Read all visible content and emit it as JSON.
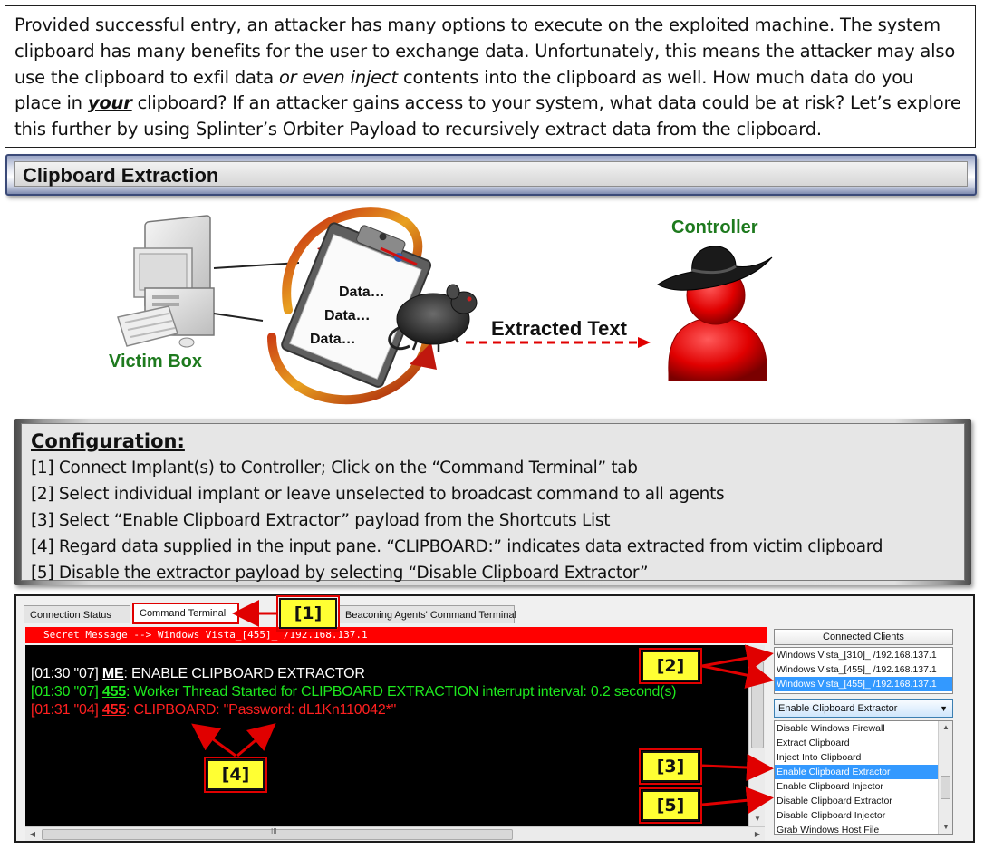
{
  "intro": {
    "line1": "Provided successful entry, an attacker has many options to execute on the exploited machine. The system",
    "line2": "clipboard has many benefits for the user to exchange data.  Unfortunately, this means the attacker may also",
    "line3_a": "use the clipboard to exfil data ",
    "line3_em": "or even inject",
    "line3_b": " contents into the clipboard as well.  How much data do you",
    "line4_a": "place in ",
    "line4_b": "your",
    "line4_c": " clipboard? If an attacker gains access to your system, what data could be at risk?  Let’s explore",
    "line5": "this further by using Splinter’s Orbiter Payload to recursively extract data from the clipboard."
  },
  "section_title": "Clipboard Extraction",
  "diagram": {
    "victim_label": "Victim Box",
    "controller_label": "Controller",
    "extracted_label": "Extracted Text",
    "clipboard_lines": [
      "Data…",
      "Data…",
      "Data…"
    ]
  },
  "configuration": {
    "title": "Configuration:",
    "steps": [
      "[1] Connect Implant(s) to Controller; Click on the “Command Terminal” tab",
      "[2] Select individual implant or leave unselected to broadcast command to all agents",
      "[3] Select “Enable Clipboard Extractor” payload from the Shortcuts List",
      "[4] Regard data supplied in the input pane.  “CLIPBOARD:” indicates data extracted from victim clipboard",
      "[5] Disable the extractor payload by selecting “Disable Clipboard Extractor”"
    ]
  },
  "app": {
    "tabs": [
      "Connection Status",
      "Command Terminal",
      "Beaconing Agents' Command Terminal"
    ],
    "active_tab": "Command Terminal",
    "secret_message": "Secret Message --> Windows Vista_[455]_ /192.168.137.1",
    "terminal": [
      {
        "time": "[01:30 \"07] ",
        "who": "ME",
        "sep": ":  ",
        "text": "ENABLE CLIPBOARD EXTRACTOR",
        "color": "white"
      },
      {
        "time": "[01:30 \"07] ",
        "who": "455",
        "sep": ":  ",
        "text": "Worker Thread Started for CLIPBOARD EXTRACTION interrupt interval: 0.2 second(s)",
        "color": "green"
      },
      {
        "time": "[01:31 \"04] ",
        "who": "455",
        "sep": ":  ",
        "text": "CLIPBOARD: \"Password: dL1Kn110042*\"",
        "color": "red"
      }
    ],
    "scroll_grip": "III",
    "clients_header": "Connected Clients",
    "clients": [
      "Windows Vista_[310]_ /192.168.137.1",
      "Windows Vista_[455]_ /192.168.137.1",
      "Windows Vista_[455]_ /192.168.137.1"
    ],
    "selected_client_index": 2,
    "combo_value": "Enable Clipboard Extractor",
    "shortcuts": [
      "Disable Windows Firewall",
      "Extract Clipboard",
      "Inject Into Clipboard",
      "Enable Clipboard Extractor",
      "Enable Clipboard Injector",
      "Disable Clipboard Extractor",
      "Disable Clipboard Injector",
      "Grab Windows Host File"
    ],
    "selected_shortcut_index": 3
  },
  "callouts": [
    "[1]",
    "[2]",
    "[3]",
    "[4]",
    "[5]"
  ],
  "colors": {
    "accent_red": "#e00000",
    "callout_yellow": "#ffff33",
    "terminal_green": "#1ee81e",
    "label_green": "#1e7a1e",
    "selection_blue": "#3399ff"
  }
}
